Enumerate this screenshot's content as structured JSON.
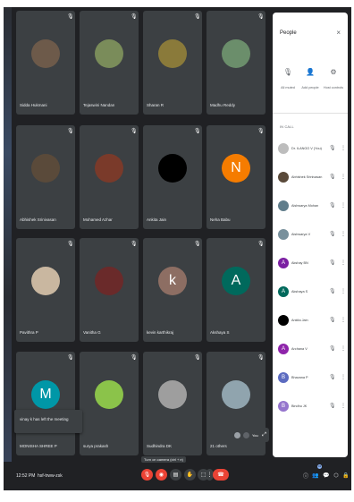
{
  "tiles": [
    {
      "name": "Sidda Hukmani",
      "avatar_color": "#6d5a4a",
      "initial": ""
    },
    {
      "name": "Tejaswini Nandan",
      "avatar_color": "#7a8c5a",
      "initial": ""
    },
    {
      "name": "Sharan R",
      "avatar_color": "#8a7a3a",
      "initial": ""
    },
    {
      "name": "Madhu Reddy",
      "avatar_color": "#6b8e6b",
      "initial": ""
    },
    {
      "name": "Abhishek Srinivasan",
      "avatar_color": "#5a4a3a",
      "initial": ""
    },
    {
      "name": "Mohamed Azhar",
      "avatar_color": "#7a3a2a",
      "initial": ""
    },
    {
      "name": "Ankita Jain",
      "avatar_color": "#000000",
      "initial": ""
    },
    {
      "name": "Neha Babu",
      "avatar_color": "#f57c00",
      "initial": "N"
    },
    {
      "name": "Pavithra P",
      "avatar_color": "#c9b7a0",
      "initial": ""
    },
    {
      "name": "Vanitha G",
      "avatar_color": "#6a2a2a",
      "initial": ""
    },
    {
      "name": "kevin karthikraj",
      "avatar_color": "#8d6e63",
      "initial": "k"
    },
    {
      "name": "Akshaya S",
      "avatar_color": "#00695c",
      "initial": "A"
    },
    {
      "name": "MONISHA SHREE P",
      "avatar_color": "#0097a7",
      "initial": "M"
    },
    {
      "name": "surya prakash",
      "avatar_color": "#8bc34a",
      "initial": ""
    },
    {
      "name": "Sudhindra DK",
      "avatar_color": "#9e9e9e",
      "initial": ""
    },
    {
      "name": "21 others",
      "avatar_color": "#90a4ae",
      "initial": ""
    }
  ],
  "toast": "vinay k has left the meeting",
  "you_tile": {
    "label": "You"
  },
  "bottom_bar": {
    "time": "12:52 PM",
    "meeting_code": "hsf-trww-zsk",
    "present_hint": "Turn on camera (ctrl + e)",
    "people_count": "34"
  },
  "panel": {
    "title": "People",
    "close": "×",
    "actions": [
      {
        "icon": "mic-off-icon",
        "label": "All muted"
      },
      {
        "icon": "add-people-icon",
        "label": "Add people"
      },
      {
        "icon": "host-controls-icon",
        "label": "Host controls"
      }
    ],
    "section_label": "IN CALL",
    "people": [
      {
        "name": "Dr. ILANGO V (You)",
        "color": "#bdbdbd",
        "initial": ""
      },
      {
        "name": "Abhishek Srinivasan",
        "color": "#5a4a3a",
        "initial": ""
      },
      {
        "name": "Aishwarya Mohan",
        "color": "#607d8b",
        "initial": ""
      },
      {
        "name": "Aishwarya V",
        "color": "#78909c",
        "initial": ""
      },
      {
        "name": "Akshay BN",
        "color": "#7b1fa2",
        "initial": "A"
      },
      {
        "name": "Akshaya S",
        "color": "#00695c",
        "initial": "A"
      },
      {
        "name": "Ankita Jain",
        "color": "#000000",
        "initial": ""
      },
      {
        "name": "Archana V",
        "color": "#8e24aa",
        "initial": "A"
      },
      {
        "name": "Bhavana P",
        "color": "#5c6bc0",
        "initial": "B"
      },
      {
        "name": "Bindhu JK",
        "color": "#9575cd",
        "initial": "B"
      }
    ]
  }
}
